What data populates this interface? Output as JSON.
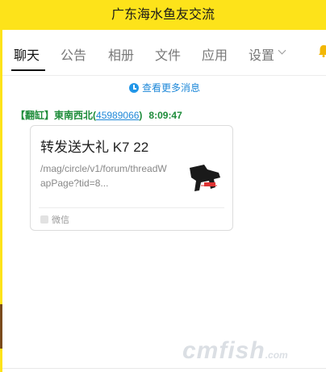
{
  "window": {
    "title": "广东海水鱼友交流"
  },
  "tabs": [
    {
      "label": "聊天",
      "active": true
    },
    {
      "label": "公告"
    },
    {
      "label": "相册"
    },
    {
      "label": "文件"
    },
    {
      "label": "应用"
    },
    {
      "label": "设置"
    }
  ],
  "feed": {
    "load_more_label": "查看更多消息"
  },
  "message": {
    "sender_tag": "【翻缸】",
    "sender_name": "東南西北",
    "sender_id_open": "(",
    "sender_id": "45989066",
    "sender_id_close": ")",
    "time": "8:09:47",
    "card": {
      "title": "转发送大礼 K7 22",
      "description": "/mag/circle/v1/forum/threadWapPage?tid=8...",
      "source": "微信"
    }
  },
  "watermark": {
    "text": "cmfish",
    "suffix": ".com"
  },
  "colors": {
    "titlebar": "#fde31a",
    "link": "#1e88d8",
    "sender": "#1e8c3a"
  },
  "icons": [
    "chevron-down-icon",
    "bell-icon",
    "clock-icon",
    "wechat-icon"
  ]
}
